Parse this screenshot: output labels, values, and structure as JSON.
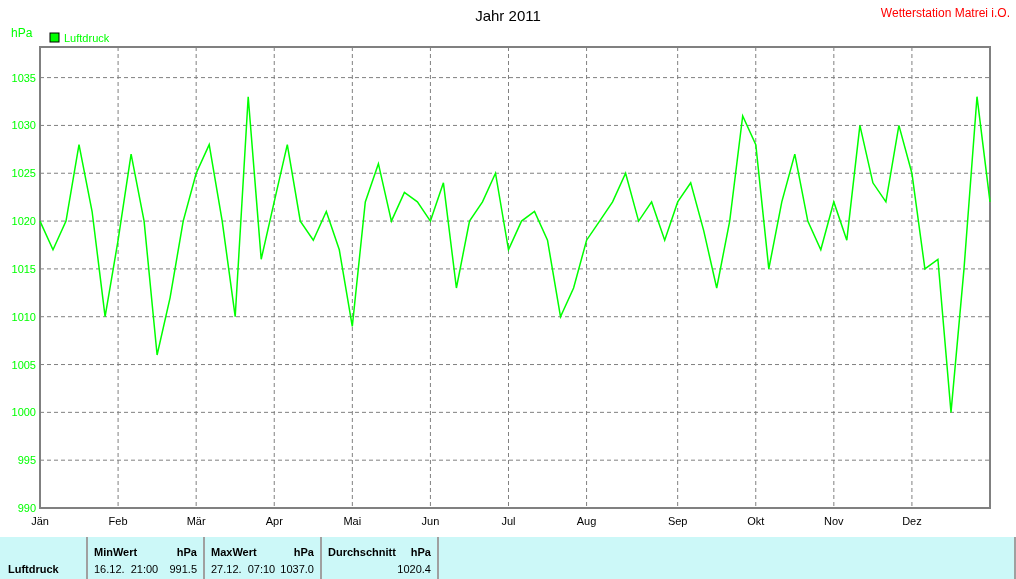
{
  "header": {
    "title": "Jahr 2011",
    "station": "Wetterstation Matrei i.O."
  },
  "chart": {
    "chart_data": {
      "type": "line",
      "ylabel": "hPa",
      "categories": [
        "Jän",
        null,
        null,
        null,
        null,
        null,
        "Feb",
        null,
        null,
        null,
        null,
        null,
        "Mär",
        null,
        null,
        null,
        null,
        null,
        "Apr",
        null,
        null,
        null,
        null,
        null,
        "Mai",
        null,
        null,
        null,
        null,
        null,
        "Jun",
        null,
        null,
        null,
        null,
        null,
        "Jul",
        null,
        null,
        null,
        null,
        null,
        "Aug",
        null,
        null,
        null,
        null,
        null,
        null,
        "Sep",
        null,
        null,
        null,
        null,
        null,
        "Okt",
        null,
        null,
        null,
        null,
        null,
        "Nov",
        null,
        null,
        null,
        null,
        null,
        "Dez",
        null,
        null,
        null,
        null,
        null,
        null
      ],
      "series": [
        {
          "name": "Luftdruck",
          "color": "#00ff00",
          "values": [
            1020,
            1017,
            1020,
            1028,
            1021,
            1010,
            1018,
            1027,
            1020,
            1006,
            1012,
            1020,
            1025,
            1028,
            1020,
            1010,
            1033,
            1016,
            1022,
            1028,
            1020,
            1018,
            1021,
            1017,
            1009,
            1022,
            1026,
            1020,
            1023,
            1022,
            1020,
            1024,
            1013,
            1020,
            1022,
            1025,
            1017,
            1020,
            1021,
            1018,
            1010,
            1013,
            1018,
            1020,
            1022,
            1025,
            1020,
            1022,
            1018,
            1022,
            1024,
            1019,
            1013,
            1020,
            1031,
            1028,
            1015,
            1022,
            1027,
            1020,
            1017,
            1022,
            1018,
            1030,
            1024,
            1022,
            1030,
            1025,
            1015,
            1016,
            1000,
            1015,
            1033,
            1022
          ]
        }
      ],
      "grid": true,
      "ylim": [
        990,
        1038.2
      ],
      "yticks": [
        990,
        995,
        1000,
        1005,
        1010,
        1015,
        1020,
        1025,
        1030,
        1035
      ]
    }
  },
  "summary": {
    "row_label": "Luftdruck",
    "groups": [
      {
        "heading": "MinWert",
        "unit": "hPa",
        "time": "16.12.  21:00",
        "value": "991.5"
      },
      {
        "heading": "MaxWert",
        "unit": "hPa",
        "time": "27.12.  07:10",
        "value": "1037.0"
      },
      {
        "heading": "Durchschnitt",
        "unit": "hPa",
        "value": "1020.4"
      }
    ]
  }
}
